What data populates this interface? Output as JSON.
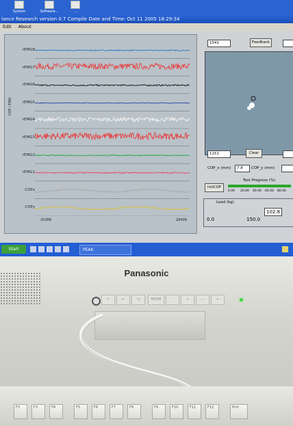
{
  "desktop": {
    "icons": [
      {
        "label": "System",
        "icon": "computer-icon"
      },
      {
        "label": "Software...",
        "icon": "folder-icon"
      },
      {
        "label": "...",
        "icon": "folder-icon"
      }
    ]
  },
  "window": {
    "title": "lance Research version 0.7 Compile Date and Time: Oct 11 2005  18:29:34",
    "menu": [
      "Edit",
      "About"
    ]
  },
  "channels": [
    {
      "label": "rEMG8",
      "color": "#2a78c8"
    },
    {
      "label": "rEMG7",
      "color": "#e83a3a"
    },
    {
      "label": "rEMG6",
      "color": "#111111"
    },
    {
      "label": "rEMG5",
      "color": "#2a44a8"
    },
    {
      "label": "rEMG4",
      "color": "#f2f2f2"
    },
    {
      "label": "rEMG3",
      "color": "#e83a3a"
    },
    {
      "label": "rEMG2",
      "color": "#22aa44"
    },
    {
      "label": "rEMG1",
      "color": "#e84a6a"
    },
    {
      "label": "COPx",
      "color": "#a9a9a9"
    },
    {
      "label": "COPy",
      "color": "#d8c040"
    }
  ],
  "plot": {
    "y_axis_label": "COP / EMG",
    "x_start": "20388",
    "x_end": "28408"
  },
  "right_panel": {
    "top_field": "1541",
    "feedback_button": "Feedback",
    "bottom_left_field": "1151",
    "clear_button": "Clear",
    "cop_x_label": "COP_x (mm)",
    "cop_x_value": "7.8",
    "cop_y_label": "COP_y (mm)",
    "initcop_button": "InitCOP",
    "test_progress_label": "Test Progress (%)",
    "progress_ticks": [
      "0.00",
      "20.00",
      "40.00",
      "60.00",
      "80.00"
    ],
    "load_label": "Load (kg)",
    "load_value": "102.8",
    "load_min": "0.0",
    "load_max": "150.0",
    "load_fraction": 0.685
  },
  "taskbar": {
    "start_label": "Start",
    "task_item": "PEAK"
  },
  "monitor": {
    "brand": "Panasonic",
    "controls": [
      "<",
      "<-",
      "<|",
      "MODE",
      "-",
      "+",
      "—",
      "+"
    ]
  },
  "keyboard": {
    "keys": [
      "F2",
      "F3",
      "F4",
      "F5",
      "F6",
      "F7",
      "F8",
      "F9",
      "F10",
      "F11",
      "F12",
      "Prnt"
    ]
  }
}
